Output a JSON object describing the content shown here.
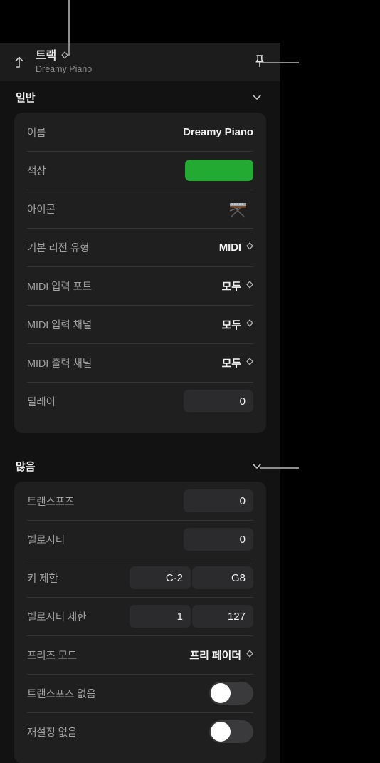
{
  "header": {
    "back_icon": "arrow-up-navigate-icon",
    "title": "트랙",
    "title_chevron_icon": "updown-chevron-icon",
    "subtitle": "Dreamy Piano",
    "pin_icon": "pin-icon"
  },
  "colors": {
    "panel_bg": "#121212",
    "header_bg": "#1c1c1c",
    "card_bg": "#1f1f1f",
    "field_bg": "#2b2b2d",
    "track_color_swatch": "#22aa33",
    "toggle_off_track": "#3a3a3c",
    "toggle_knob": "#ffffff",
    "label_text": "#a2a2a2",
    "value_text": "#f2f2f2",
    "leader_line": "#8e8e8e"
  },
  "sections": [
    {
      "title": "일반",
      "chevron_icon": "chevron-down-icon",
      "rows": [
        {
          "name": "name",
          "label": "이름",
          "type": "text",
          "value": "Dreamy Piano"
        },
        {
          "name": "color",
          "label": "색상",
          "type": "swatch",
          "value": "#22aa33"
        },
        {
          "name": "icon",
          "label": "아이콘",
          "type": "icon",
          "value": "keyboard-on-stand-icon"
        },
        {
          "name": "default-region-type",
          "label": "기본 리전 유형",
          "type": "popup",
          "value": "MIDI"
        },
        {
          "name": "midi-input-port",
          "label": "MIDI 입력 포트",
          "type": "popup",
          "value": "모두"
        },
        {
          "name": "midi-input-channel",
          "label": "MIDI 입력 채널",
          "type": "popup",
          "value": "모두"
        },
        {
          "name": "midi-output-channel",
          "label": "MIDI 출력 채널",
          "type": "popup",
          "value": "모두"
        },
        {
          "name": "delay",
          "label": "딜레이",
          "type": "field",
          "value": "0"
        }
      ]
    },
    {
      "title": "많음",
      "chevron_icon": "chevron-down-icon",
      "rows": [
        {
          "name": "transpose",
          "label": "트랜스포즈",
          "type": "field",
          "value": "0"
        },
        {
          "name": "velocity",
          "label": "벨로시티",
          "type": "field",
          "value": "0"
        },
        {
          "name": "key-limit",
          "label": "키 제한",
          "type": "dual-field",
          "value": "C-2",
          "value2": "G8"
        },
        {
          "name": "velocity-limit",
          "label": "벨로시티 제한",
          "type": "dual-field",
          "value": "1",
          "value2": "127"
        },
        {
          "name": "freeze-mode",
          "label": "프리즈 모드",
          "type": "popup",
          "value": "프리 페이더"
        },
        {
          "name": "no-transpose",
          "label": "트랜스포즈 없음",
          "type": "toggle",
          "value": "off"
        },
        {
          "name": "no-reset",
          "label": "재설정 없음",
          "type": "toggle",
          "value": "off"
        }
      ]
    }
  ]
}
